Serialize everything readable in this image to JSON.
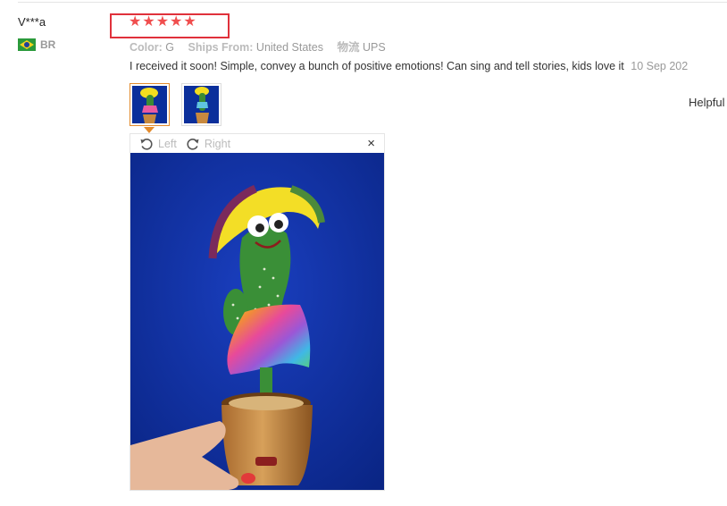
{
  "review": {
    "username": "V***a",
    "country_code": "BR",
    "rating": 5,
    "meta": {
      "color_label": "Color:",
      "color_value": "G",
      "ships_label": "Ships From:",
      "ships_value": "United States",
      "carrier_label": "物流",
      "carrier_value": "UPS"
    },
    "text": "I received it soon! Simple, convey a bunch of positive emotions! Can sing and tell stories, kids love it",
    "date": "10 Sep 202",
    "helpful_label": "Helpful"
  },
  "viewer": {
    "rotate_left_label": "Left",
    "rotate_right_label": "Right",
    "close_symbol": "×"
  },
  "icons": {
    "star": "star-icon",
    "flag": "brazil-flag-icon",
    "rotate_left": "rotate-left-icon",
    "rotate_right": "rotate-right-icon",
    "close": "close-icon"
  },
  "colors": {
    "star": "#f04e4e",
    "highlight_box": "#e0313b",
    "active_thumb": "#e38b2d",
    "photo_background": "#0d2fa6"
  }
}
